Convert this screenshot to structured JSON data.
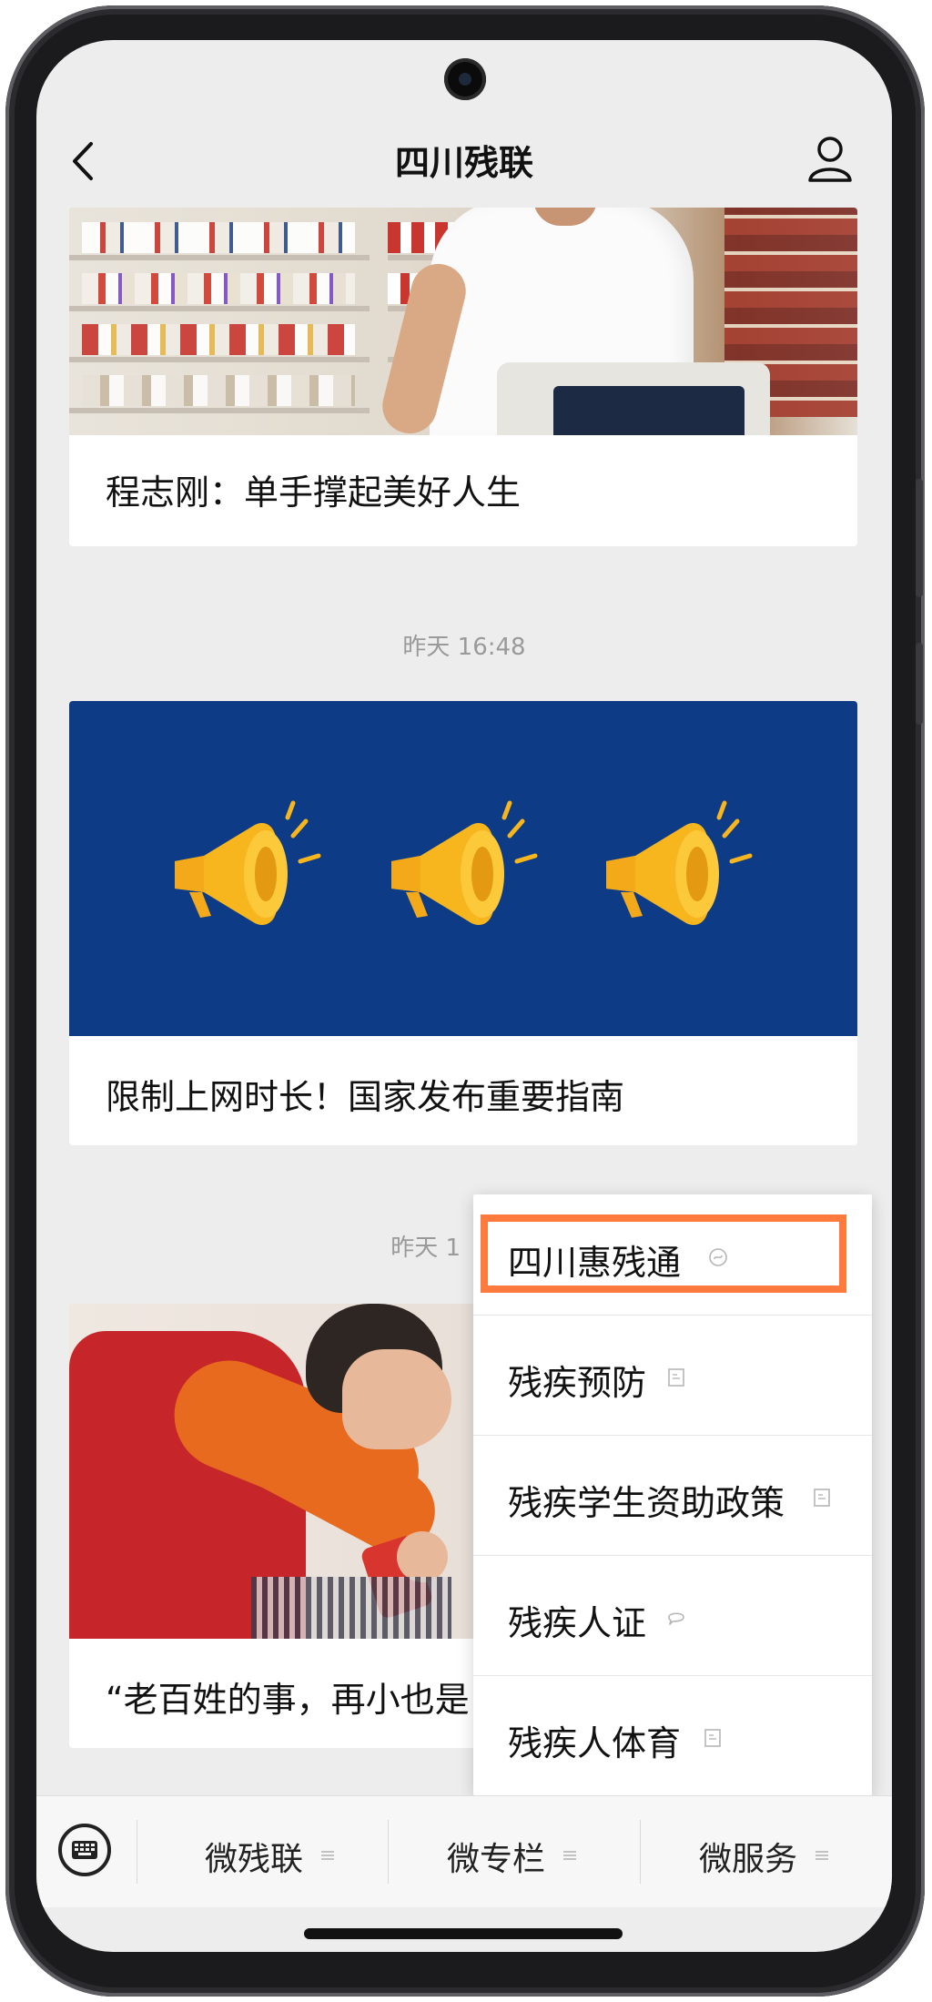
{
  "header": {
    "title": "四川残联"
  },
  "feed": [
    {
      "title": "程志刚：单手撑起美好人生"
    },
    {
      "timestamp": "昨天 16:48",
      "title": "限制上网时长！国家发布重要指南"
    },
    {
      "timestamp": "昨天 1",
      "title": "“老百姓的事，再小也是"
    }
  ],
  "popup_menu": {
    "items": [
      {
        "label": "四川惠残通",
        "icon": "mini-program-icon",
        "highlighted": true
      },
      {
        "label": "残疾预防",
        "icon": "article-icon"
      },
      {
        "label": "残疾学生资助政策",
        "icon": "article-icon"
      },
      {
        "label": "残疾人证",
        "icon": "chat-bubble-icon"
      },
      {
        "label": "残疾人体育",
        "icon": "article-icon"
      }
    ]
  },
  "bottom_menu": {
    "items": [
      {
        "label": "微残联"
      },
      {
        "label": "微专栏"
      },
      {
        "label": "微服务"
      }
    ]
  },
  "colors": {
    "highlight": "#ff7a3d",
    "banner_bg": "#0e3b86",
    "megaphone": "#f7b51e",
    "screen_bg": "#ededed"
  }
}
